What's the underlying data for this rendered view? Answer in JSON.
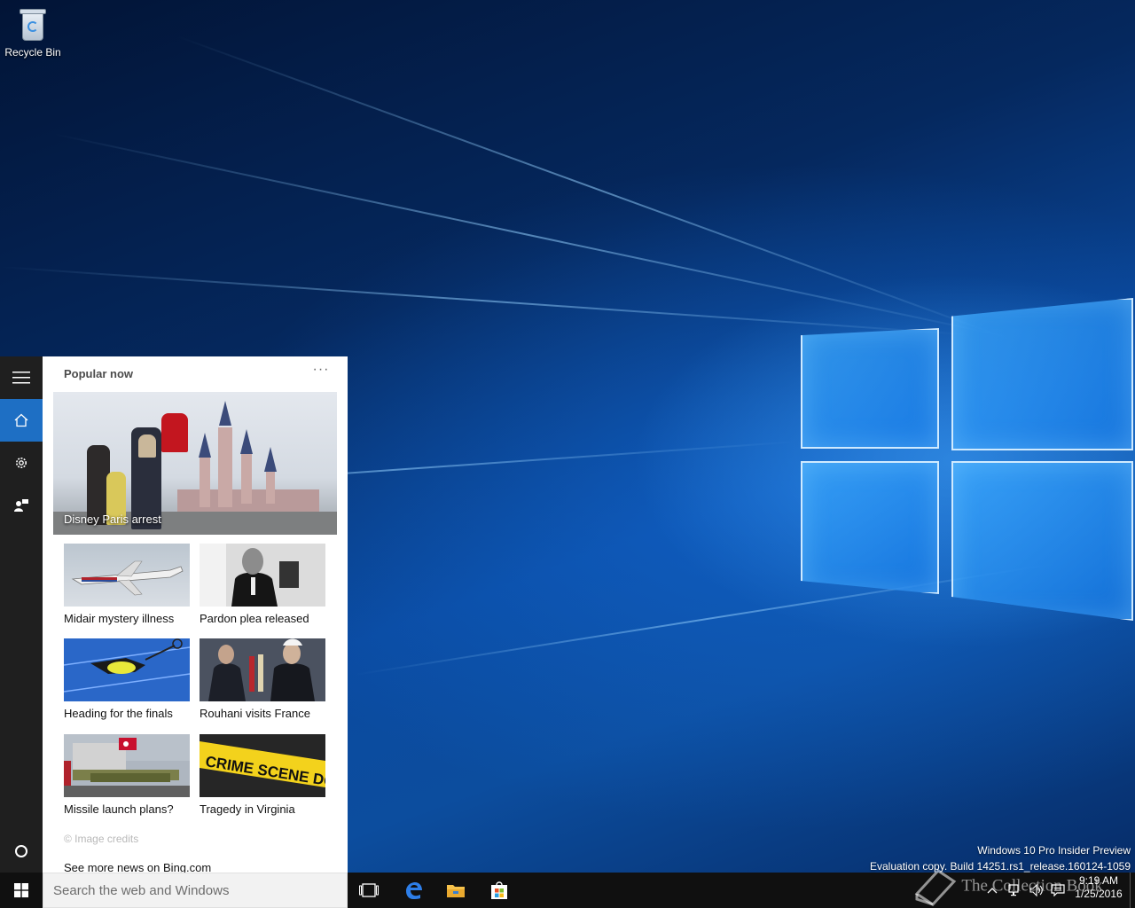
{
  "desktop": {
    "icons": [
      {
        "label": "Recycle Bin",
        "icon": "recycle-bin-icon"
      }
    ],
    "watermark": {
      "line1": "Windows 10 Pro Insider Preview",
      "line2": "Evaluation copy. Build 14251.rs1_release.160124-1059"
    },
    "brand": "The Collection Book"
  },
  "cortana": {
    "rail": {
      "menu_icon": "hamburger-icon",
      "items": [
        {
          "id": "home",
          "icon": "home-icon",
          "active": true
        },
        {
          "id": "settings",
          "icon": "gear-icon",
          "active": false
        },
        {
          "id": "feedback",
          "icon": "feedback-icon",
          "active": false
        }
      ],
      "cortana_icon": "cortana-circle-icon"
    },
    "section_title": "Popular now",
    "more_label": "···",
    "hero": {
      "caption": "Disney Paris arrest"
    },
    "tiles": [
      {
        "label": "Midair mystery illness"
      },
      {
        "label": "Pardon plea released"
      },
      {
        "label": "Heading for the finals"
      },
      {
        "label": "Rouhani visits France"
      },
      {
        "label": "Missile launch plans?"
      },
      {
        "label": "Tragedy in Virginia"
      }
    ],
    "crime_text": "CRIME SCENE DO NOT CROSS",
    "image_credits": "© Image credits",
    "see_more": "See more news on Bing.com"
  },
  "taskbar": {
    "search_placeholder": "Search the web and Windows",
    "clock": {
      "time": "9:19 AM",
      "date": "1/25/2016"
    },
    "colors": {
      "accent": "#1e6fc4",
      "taskbar": "#101010"
    }
  }
}
